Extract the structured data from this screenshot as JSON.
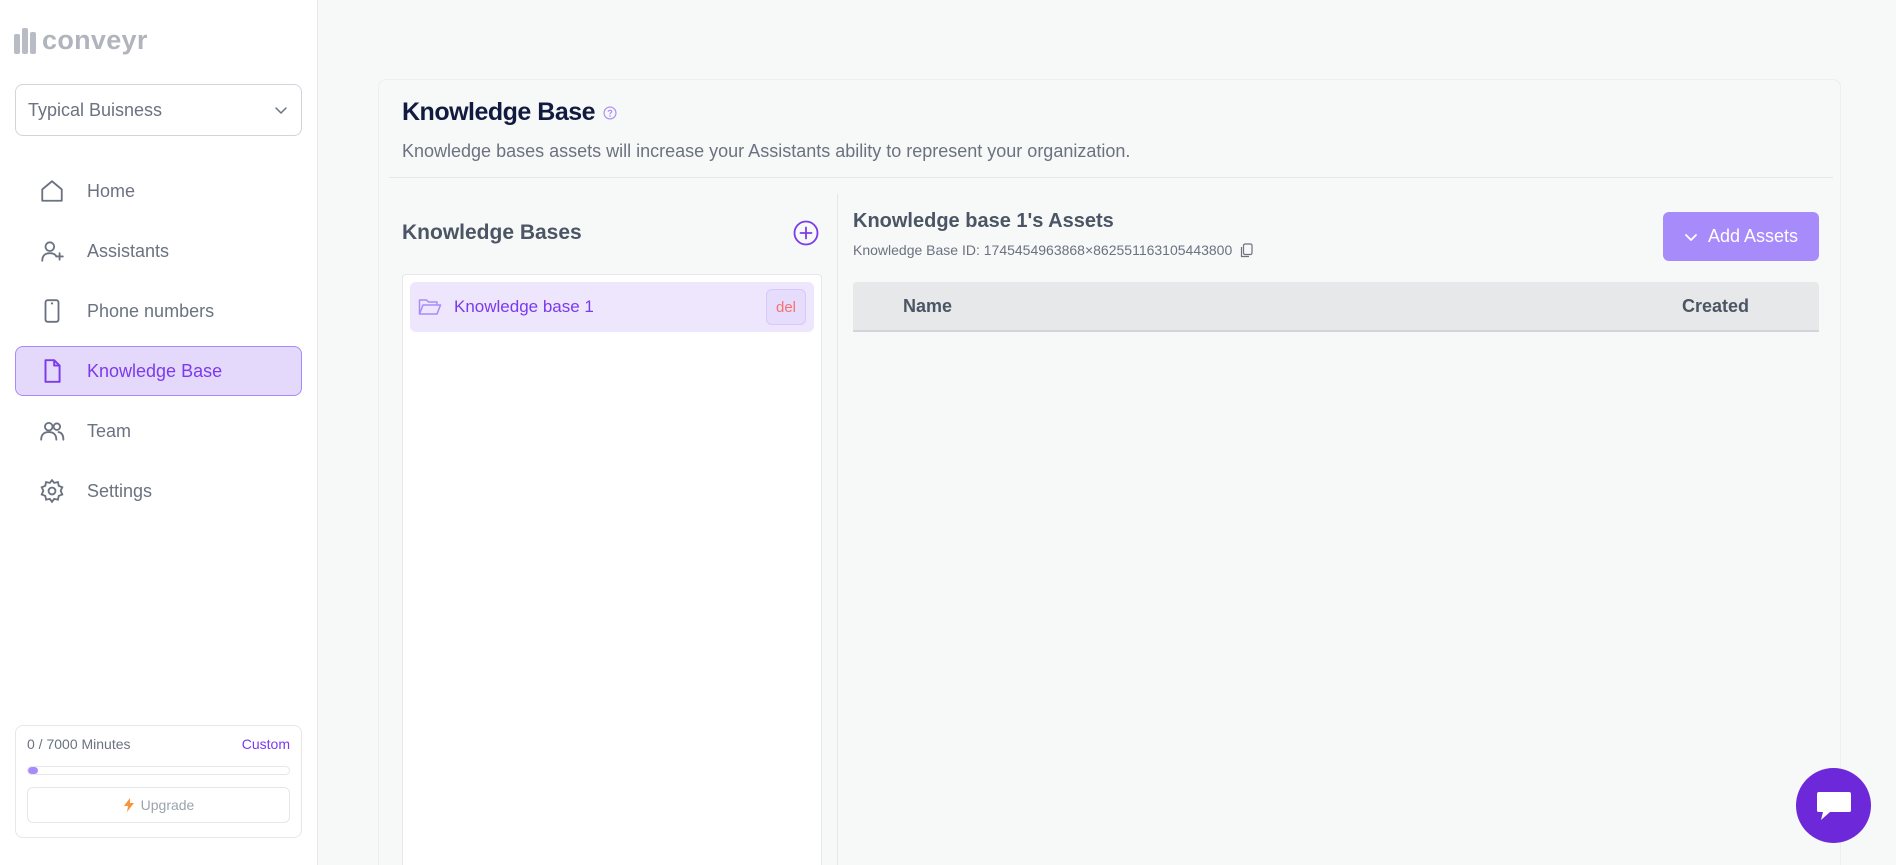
{
  "app": {
    "logo_text": "conveyr"
  },
  "org": {
    "selected": "Typical Buisness"
  },
  "nav": {
    "items": [
      {
        "label": "Home",
        "icon": "home-icon"
      },
      {
        "label": "Assistants",
        "icon": "user-plus-icon"
      },
      {
        "label": "Phone numbers",
        "icon": "phone-icon"
      },
      {
        "label": "Knowledge Base",
        "icon": "document-icon",
        "active": true
      },
      {
        "label": "Team",
        "icon": "users-icon"
      },
      {
        "label": "Settings",
        "icon": "gear-icon"
      }
    ]
  },
  "usage": {
    "text": "0 / 7000 Minutes",
    "plan": "Custom",
    "progress_fraction": 0,
    "upgrade_label": "Upgrade"
  },
  "page": {
    "title": "Knowledge Base",
    "subtitle": "Knowledge bases assets will increase your Assistants ability to represent your organization."
  },
  "kb_panel": {
    "title": "Knowledge Bases",
    "items": [
      {
        "name": "Knowledge base 1",
        "delete_label": "del"
      }
    ]
  },
  "assets": {
    "title": "Knowledge base 1's Assets",
    "kb_id_text": "Knowledge Base ID: 1745454963868×862551163105443800",
    "add_label": "Add Assets",
    "columns": [
      "Name",
      "Created"
    ]
  },
  "colors": {
    "accent": "#7c3aed",
    "accent_light": "#a78bfa",
    "active_bg": "#e4d9fb",
    "delete_text": "#f87171",
    "chat_button": "#6d28d9"
  }
}
